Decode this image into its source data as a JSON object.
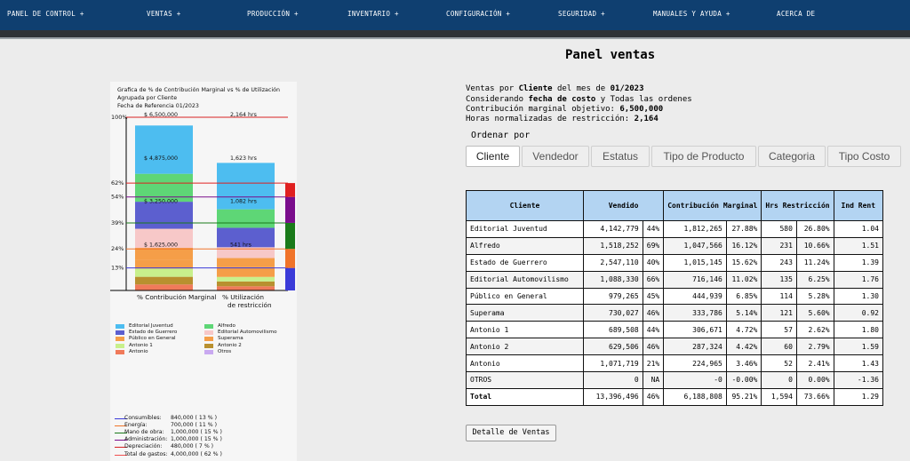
{
  "nav": {
    "items": [
      "PANEL DE CONTROL +",
      "VENTAS      +",
      "PRODUCCIÓN +",
      "INVENTARIO +",
      "CONFIGURACIÓN +",
      "SEGURIDAD +",
      "MANUALES Y AYUDA +",
      "ACERCA DE"
    ]
  },
  "colors": {
    "nav_bg": "#0f3f70",
    "header_cell": "#b3d4f2",
    "dark_bar": "#2f3237"
  },
  "page": {
    "title": "Panel ventas",
    "info": {
      "line1_pre": "Ventas por ",
      "line1_bold": "Cliente",
      "line1_mid": " del mes de ",
      "line1_bold2": "01/2023",
      "line2_pre": "Considerando ",
      "line2_bold": "fecha de costo",
      "line2_post": " y Todas las ordenes",
      "line3_pre": "Contribución marginal objetivo: ",
      "line3_bold": "6,500,000",
      "line4_pre": "Horas normalizadas de restricción: ",
      "line4_bold": "2,164"
    },
    "order_label": "Ordenar por",
    "tabs": [
      "Cliente",
      "Vendedor",
      "Estatus",
      "Tipo de Producto",
      "Categoria",
      "Tipo Costo"
    ],
    "detail_button": "Detalle de Ventas"
  },
  "table": {
    "headers": [
      "Cliente",
      "Vendido",
      "Contribución Marginal",
      "Hrs Restricción",
      "Ind Rent"
    ],
    "rows": [
      [
        "Editorial Juventud",
        "4,142,779",
        "44%",
        "1,812,265",
        "27.88%",
        "580",
        "26.80%",
        "1.04"
      ],
      [
        "Alfredo",
        "1,518,252",
        "69%",
        "1,047,566",
        "16.12%",
        "231",
        "10.66%",
        "1.51"
      ],
      [
        "Estado de Guerrero",
        "2,547,110",
        "40%",
        "1,015,145",
        "15.62%",
        "243",
        "11.24%",
        "1.39"
      ],
      [
        "Editorial Automovilismo",
        "1,088,330",
        "66%",
        "716,146",
        "11.02%",
        "135",
        "6.25%",
        "1.76"
      ],
      [
        "Público en General",
        "979,265",
        "45%",
        "444,939",
        "6.85%",
        "114",
        "5.28%",
        "1.30"
      ],
      [
        "Superama",
        "730,027",
        "46%",
        "333,786",
        "5.14%",
        "121",
        "5.60%",
        "0.92"
      ],
      [
        "Antonio 1",
        "689,508",
        "44%",
        "306,671",
        "4.72%",
        "57",
        "2.62%",
        "1.80"
      ],
      [
        "Antonio 2",
        "629,506",
        "46%",
        "287,324",
        "4.42%",
        "60",
        "2.79%",
        "1.59"
      ],
      [
        "Antonio",
        "1,071,719",
        "21%",
        "224,965",
        "3.46%",
        "52",
        "2.41%",
        "1.43"
      ],
      [
        "OTROS",
        "0",
        "NA",
        "-0",
        "-0.00%",
        "0",
        "0.00%",
        "-1.36"
      ]
    ],
    "total": [
      "Total",
      "13,396,496",
      "46%",
      "6,188,808",
      "95.21%",
      "1,594",
      "73.66%",
      "1.29"
    ]
  },
  "chart_data": {
    "type": "bar",
    "title": "Grafica de % de Contribución Marginal vs % de Utilización",
    "subtitle1": "Agrupada por Cliente",
    "subtitle2": "Fecha de Referencia 01/2023",
    "categories": [
      "% Contribución Marginal",
      "% Utilización de restricción"
    ],
    "ylim": [
      0,
      100
    ],
    "y_ticks": [
      "100%",
      "62%",
      "54%",
      "39%",
      "24%",
      "13%"
    ],
    "annotations_bar1": [
      "$ 6,500,000",
      "$ 4,875,000",
      "$ 3,250,000",
      "$ 1,625,000"
    ],
    "annotations_bar2": [
      "2,164 hrs",
      "1,623 hrs",
      "1,082 hrs",
      "541 hrs"
    ],
    "series": [
      {
        "name": "Editorial Juventud",
        "color": "#4dbdf0",
        "values": [
          27.88,
          26.8
        ]
      },
      {
        "name": "Alfredo",
        "color": "#5ed676",
        "values": [
          16.12,
          10.66
        ]
      },
      {
        "name": "Estado de Guerrero",
        "color": "#5c5fcf",
        "values": [
          15.62,
          11.24
        ]
      },
      {
        "name": "Editorial Automovilismo",
        "color": "#f7c8c8",
        "values": [
          11.02,
          6.25
        ]
      },
      {
        "name": "Público en General",
        "color": "#f59e48",
        "values": [
          6.85,
          5.28
        ]
      },
      {
        "name": "Superama",
        "color": "#f59e48",
        "values": [
          5.14,
          5.6
        ]
      },
      {
        "name": "Antonio 1",
        "color": "#c8f08c",
        "values": [
          4.72,
          2.62
        ]
      },
      {
        "name": "Antonio 2",
        "color": "#b8902f",
        "values": [
          4.42,
          2.79
        ]
      },
      {
        "name": "Antonio",
        "color": "#f07a5a",
        "values": [
          3.46,
          2.41
        ]
      },
      {
        "name": "Otros",
        "color": "#c9a9f0",
        "values": [
          0,
          0
        ]
      }
    ],
    "reference_lines": [
      {
        "label": "Consumibles:",
        "value_text": "840,000  ( 13 % )",
        "color": "#3b3bd8",
        "percent": 13
      },
      {
        "label": "Energía:",
        "value_text": "700,000  ( 11 % )",
        "color": "#f0742a",
        "percent": 24
      },
      {
        "label": "Mano de obra:",
        "value_text": "1,000,000  ( 15 % )",
        "color": "#1a7a1a",
        "percent": 39
      },
      {
        "label": "Administración:",
        "value_text": "1,000,000  ( 15 % )",
        "color": "#7a0d8c",
        "percent": 54
      },
      {
        "label": "Depreciación:",
        "value_text": "480,000  ( 7 % )",
        "color": "#d82222",
        "percent": 62
      },
      {
        "label": "Total de gastos:",
        "value_text": "4,000,000  ( 62 % )",
        "color": "#f05050",
        "percent": 62
      }
    ],
    "side_bands": [
      "#3b3bd8",
      "#f0742a",
      "#1a7a1a",
      "#7a0d8c",
      "#e02020"
    ]
  }
}
